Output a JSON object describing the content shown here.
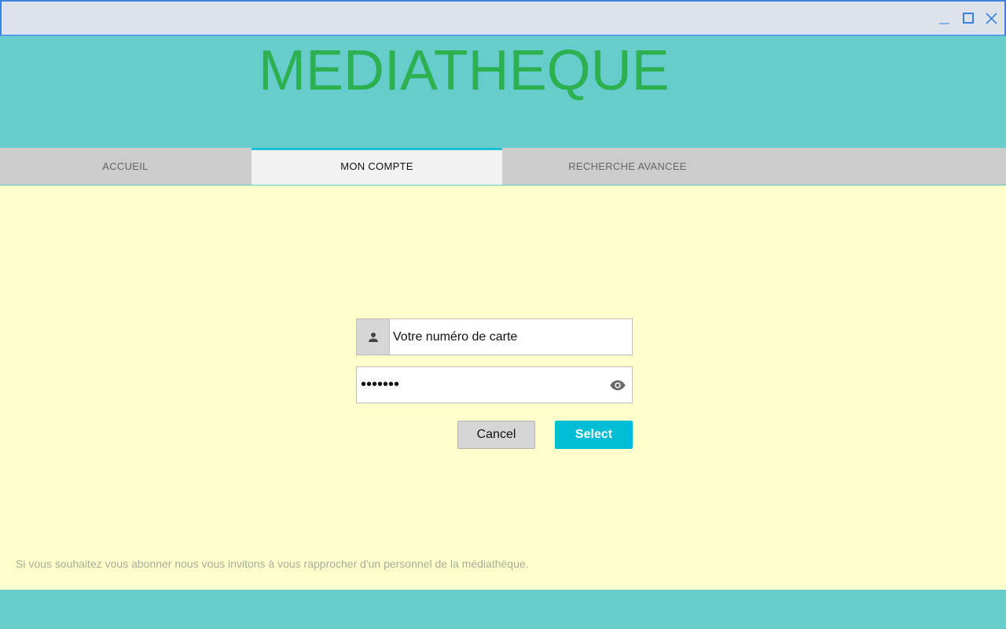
{
  "window": {
    "controls": [
      {
        "name": "minimize",
        "icon": "minimize-icon"
      },
      {
        "name": "maximize",
        "icon": "maximize-icon"
      },
      {
        "name": "close",
        "icon": "close-icon"
      }
    ]
  },
  "header": {
    "title": "MEDIATHEQUE"
  },
  "tabs": [
    {
      "label": "ACCUEIL",
      "active": false
    },
    {
      "label": "MON COMPTE",
      "active": true
    },
    {
      "label": "RECHERCHE AVANCEE",
      "active": false
    }
  ],
  "login": {
    "card_field": {
      "value": "Votre numéro de carte",
      "icon": "user-icon"
    },
    "password_field": {
      "masked_value": "•••••••",
      "icon": "eye-icon"
    },
    "cancel_label": "Cancel",
    "select_label": "Select"
  },
  "footer": {
    "note": "Si vous souhaitez vous abonner nous vous invitons à vous rapprocher d'un personnel de la médiathèque."
  },
  "colors": {
    "background": "#66cccc",
    "content": "#ffffcc",
    "title": "#2db04f",
    "accent": "#00bcd4",
    "tabbar": "#cccccc",
    "active_tab": "#f2f2f2"
  }
}
